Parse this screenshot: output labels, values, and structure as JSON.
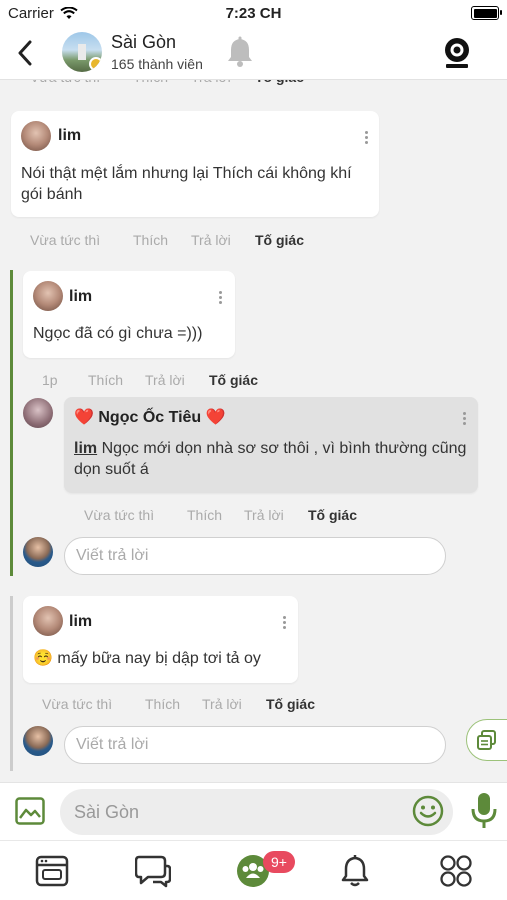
{
  "status_bar": {
    "carrier": "Carrier",
    "time": "7:23 CH"
  },
  "header": {
    "title": "Sài Gòn",
    "members": "165 thành viên"
  },
  "actions": {
    "just_now": "Vừa tức thì",
    "like": "Thích",
    "reply": "Trả lời",
    "report": "Tố giác",
    "one_minute": "1p"
  },
  "comments": [
    {
      "author": "lim",
      "text": "Nói thật mệt lắm nhưng lại Thích cái không khí gói bánh"
    },
    {
      "author": "lim",
      "text": "Ngọc đã có gì chưa =)))"
    },
    {
      "author": "❤️ Ngọc Ốc Tiêu ❤️",
      "mention": "lim",
      "text": " Ngọc mới dọn nhà sơ sơ thôi , vì bình thường cũng dọn suốt á"
    },
    {
      "author": "lim",
      "emoji": "☺️",
      "text": " mấy bữa nay bị dập tơi tả oy"
    }
  ],
  "reply_placeholder": "Viết trả lời",
  "composer": {
    "placeholder": "Sài Gòn"
  },
  "bottom_nav": {
    "badge": "9+"
  },
  "colors": {
    "accent": "#5d8a3a",
    "badge": "#e84a5f"
  }
}
